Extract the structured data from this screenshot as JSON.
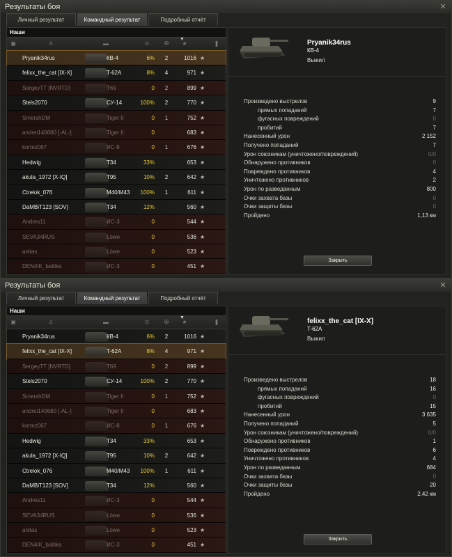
{
  "title": "Результаты боя",
  "tabs": [
    "Личный результат",
    "Командный результат",
    "Подробный отчёт"
  ],
  "team_label": "Наши",
  "close_button": "Закрыть",
  "icons": {
    "column_icons": [
      "vehicle-type-icon",
      "player-icon",
      "tank-icon",
      "damage-icon",
      "kills-icon",
      "xp-icon",
      "medal-icon"
    ],
    "close": "close-icon"
  },
  "colors": {
    "alive_row": "#1a1a18",
    "dead_row": "#2a1512",
    "damage_yellow": "#e8cc40",
    "selected_row": "#47341f"
  },
  "players": [
    {
      "name": "Pryanik34rus",
      "tank": "КВ-4",
      "dmg": "6%",
      "kills": "2",
      "xp": "1016",
      "alive": true
    },
    {
      "name": "felixx_the_cat [IX-X]",
      "tank": "T-62A",
      "dmg": "8%",
      "kills": "4",
      "xp": "971",
      "alive": true
    },
    {
      "name": "SergeyTT [NVRTD]",
      "tank": "T69",
      "dmg": "0",
      "kills": "2",
      "xp": "899",
      "alive": false
    },
    {
      "name": "Stels2070",
      "tank": "СУ-14",
      "dmg": "100%",
      "kills": "2",
      "xp": "770",
      "alive": true
    },
    {
      "name": "SmershDM",
      "tank": "Tiger II",
      "dmg": "0",
      "kills": "1",
      "xp": "752",
      "alive": false
    },
    {
      "name": "andrei140680 [-AL-]",
      "tank": "Tiger II",
      "dmg": "0",
      "kills": "",
      "xp": "683",
      "alive": false
    },
    {
      "name": "kortez067",
      "tank": "ИС-8",
      "dmg": "0",
      "kills": "1",
      "xp": "676",
      "alive": false
    },
    {
      "name": "Hedwig",
      "tank": "T34",
      "dmg": "33%",
      "kills": "",
      "xp": "653",
      "alive": true
    },
    {
      "name": "akula_1972 [X-IQ]",
      "tank": "T95",
      "dmg": "10%",
      "kills": "2",
      "xp": "642",
      "alive": true
    },
    {
      "name": "Ctrelok_076",
      "tank": "M40/M43",
      "dmg": "100%",
      "kills": "1",
      "xp": "611",
      "alive": true
    },
    {
      "name": "DaMBiT123 [SOV]",
      "tank": "T34",
      "dmg": "12%",
      "kills": "",
      "xp": "560",
      "alive": true
    },
    {
      "name": "Andres11",
      "tank": "ИС-3",
      "dmg": "0",
      "kills": "",
      "xp": "544",
      "alive": false
    },
    {
      "name": "SEVA34RUS",
      "tank": "Löwe",
      "dmg": "0",
      "kills": "",
      "xp": "536",
      "alive": false
    },
    {
      "name": "anitas",
      "tank": "Löwe",
      "dmg": "0",
      "kills": "",
      "xp": "523",
      "alive": false
    },
    {
      "name": "DEN4IK_baltika",
      "tank": "ИС-3",
      "dmg": "0",
      "kills": "",
      "xp": "451",
      "alive": false
    }
  ],
  "stat_labels": [
    "Произведено выстрелов",
    "прямых попаданий",
    "фугасных повреждений",
    "пробитий",
    "Нанесенный урон",
    "Получено попаданий",
    "Урон союзникам (уничтожено/повреждений)",
    "Обнаружено противников",
    "Повреждено противников",
    "Уничтожено противников",
    "Урон по разведанным",
    "Очки захвата базы",
    "Очки защиты базы",
    "Пройдено"
  ],
  "windows": [
    {
      "selected_index": 0,
      "detail": {
        "name": "Pryanik34rus",
        "tank": "КВ-4",
        "status": "Выжил",
        "stats": [
          "9",
          "7",
          "0",
          "7",
          "2 152",
          "7",
          "0/0",
          "0",
          "4",
          "2",
          "800",
          "0",
          "0",
          "1,13 км"
        ]
      }
    },
    {
      "selected_index": 1,
      "detail": {
        "name": "felixx_the_cat [IX-X]",
        "tank": "T-62A",
        "status": "Выжил",
        "stats": [
          "18",
          "16",
          "0",
          "15",
          "3 635",
          "5",
          "0/0",
          "1",
          "6",
          "4",
          "684",
          "0",
          "20",
          "2,42 км"
        ]
      }
    }
  ]
}
